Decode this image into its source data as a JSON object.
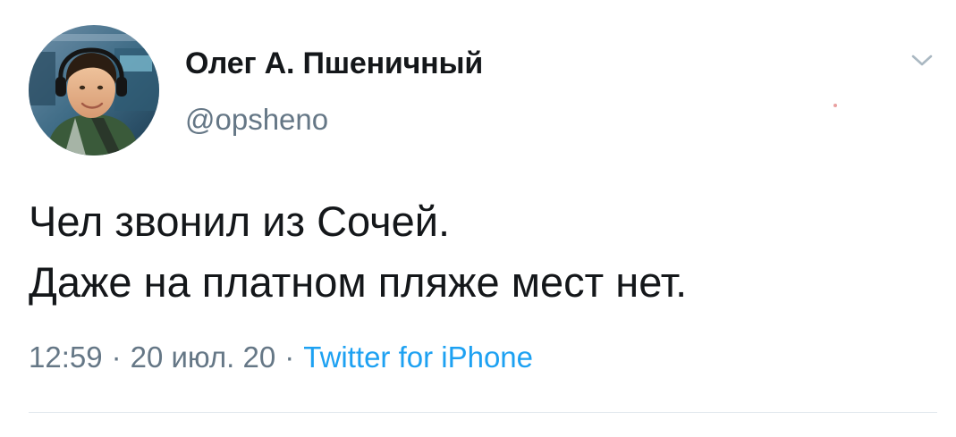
{
  "tweet": {
    "author": {
      "display_name": "Олег А. Пшеничный",
      "handle": "@opsheno",
      "avatar_icon": "user-avatar-photo"
    },
    "menu_icon": "chevron-down-icon",
    "text_lines": [
      "Чел звонил из Сочей.",
      "Даже на платном пляже мест нет."
    ],
    "meta": {
      "time": "12:59",
      "separator": "·",
      "date": "20 июл. 20",
      "source": "Twitter for iPhone"
    }
  },
  "colors": {
    "text_primary": "#14171a",
    "text_secondary": "#657786",
    "link": "#1da1f2",
    "divider": "#e1e8ed"
  }
}
